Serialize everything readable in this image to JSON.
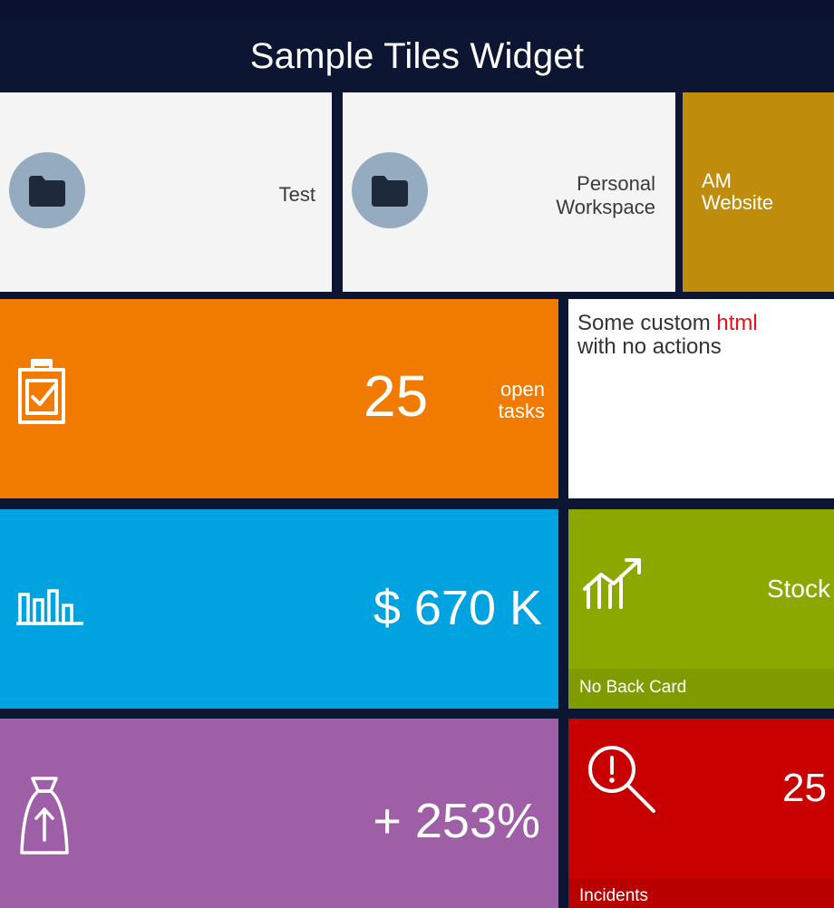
{
  "header": {
    "title": "Sample Tiles Widget"
  },
  "tiles": {
    "test": {
      "label": "Test",
      "icon": "folder-icon",
      "bg": "#f4f4f4"
    },
    "personal_workspace": {
      "label_line1": "Personal",
      "label_line2": "Workspace",
      "icon": "folder-icon",
      "bg": "#f4f4f4"
    },
    "am_website": {
      "label_line1": "AM",
      "label_line2": "Website",
      "bg": "#bf8c0c"
    },
    "tasks": {
      "value": "25",
      "sub_line1": "open",
      "sub_line2": "tasks",
      "icon": "clipboard-check-icon",
      "bg": "#f07b00"
    },
    "custom_html": {
      "text_before": "Some custom ",
      "text_red": "html",
      "text_after": "with no actions",
      "bg": "#ffffff",
      "accent": "#e8101a"
    },
    "revenue": {
      "value": "$ 670 K",
      "icon": "bar-chart-icon",
      "bg": "#00a3e0"
    },
    "stock": {
      "label": "Stock",
      "footer": "No Back Card",
      "icon": "trend-up-icon",
      "bg": "#8aa800"
    },
    "growth": {
      "value": "+ 253%",
      "icon": "money-bag-up-icon",
      "bg": "#9f5fa6"
    },
    "incidents": {
      "value": "25",
      "footer": "Incidents",
      "icon": "search-alert-icon",
      "bg": "#c80000"
    }
  }
}
